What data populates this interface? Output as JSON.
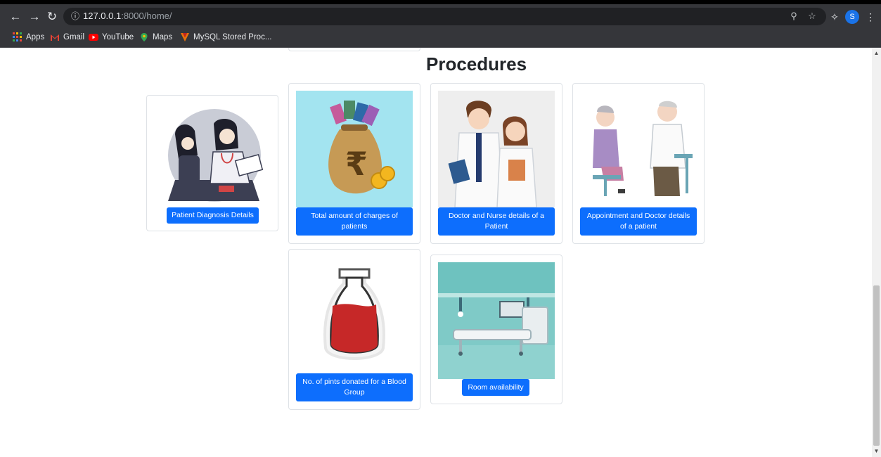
{
  "browser": {
    "url_host": "127.0.0.1",
    "url_path": ":8000/home/",
    "profile_initial": "S"
  },
  "bookmarks": [
    {
      "label": "Apps",
      "icon": "apps-grid-icon"
    },
    {
      "label": "Gmail",
      "icon": "gmail-icon"
    },
    {
      "label": "YouTube",
      "icon": "youtube-icon"
    },
    {
      "label": "Maps",
      "icon": "maps-icon"
    },
    {
      "label": "MySQL Stored Proc...",
      "icon": "mysql-icon"
    }
  ],
  "page": {
    "heading": "Procedures",
    "cards": [
      {
        "button": "Patient Diagnosis Details",
        "image": "doctor-consultation-illustration"
      },
      {
        "button": "Total amount of charges of patients",
        "image": "rupee-money-bag-illustration"
      },
      {
        "button": "Doctor and Nurse details of a Patient",
        "image": "doctor-nurse-illustration"
      },
      {
        "button": "Appointment and Doctor details of a patient",
        "image": "elderly-patient-doctor-illustration"
      },
      {
        "button": "No. of pints donated for a Blood Group",
        "image": "blood-bottle-illustration"
      },
      {
        "button": "Room availability",
        "image": "hospital-room-illustration"
      }
    ]
  },
  "colors": {
    "primary_button": "#0d6efd",
    "chrome_bar": "#35363a"
  }
}
